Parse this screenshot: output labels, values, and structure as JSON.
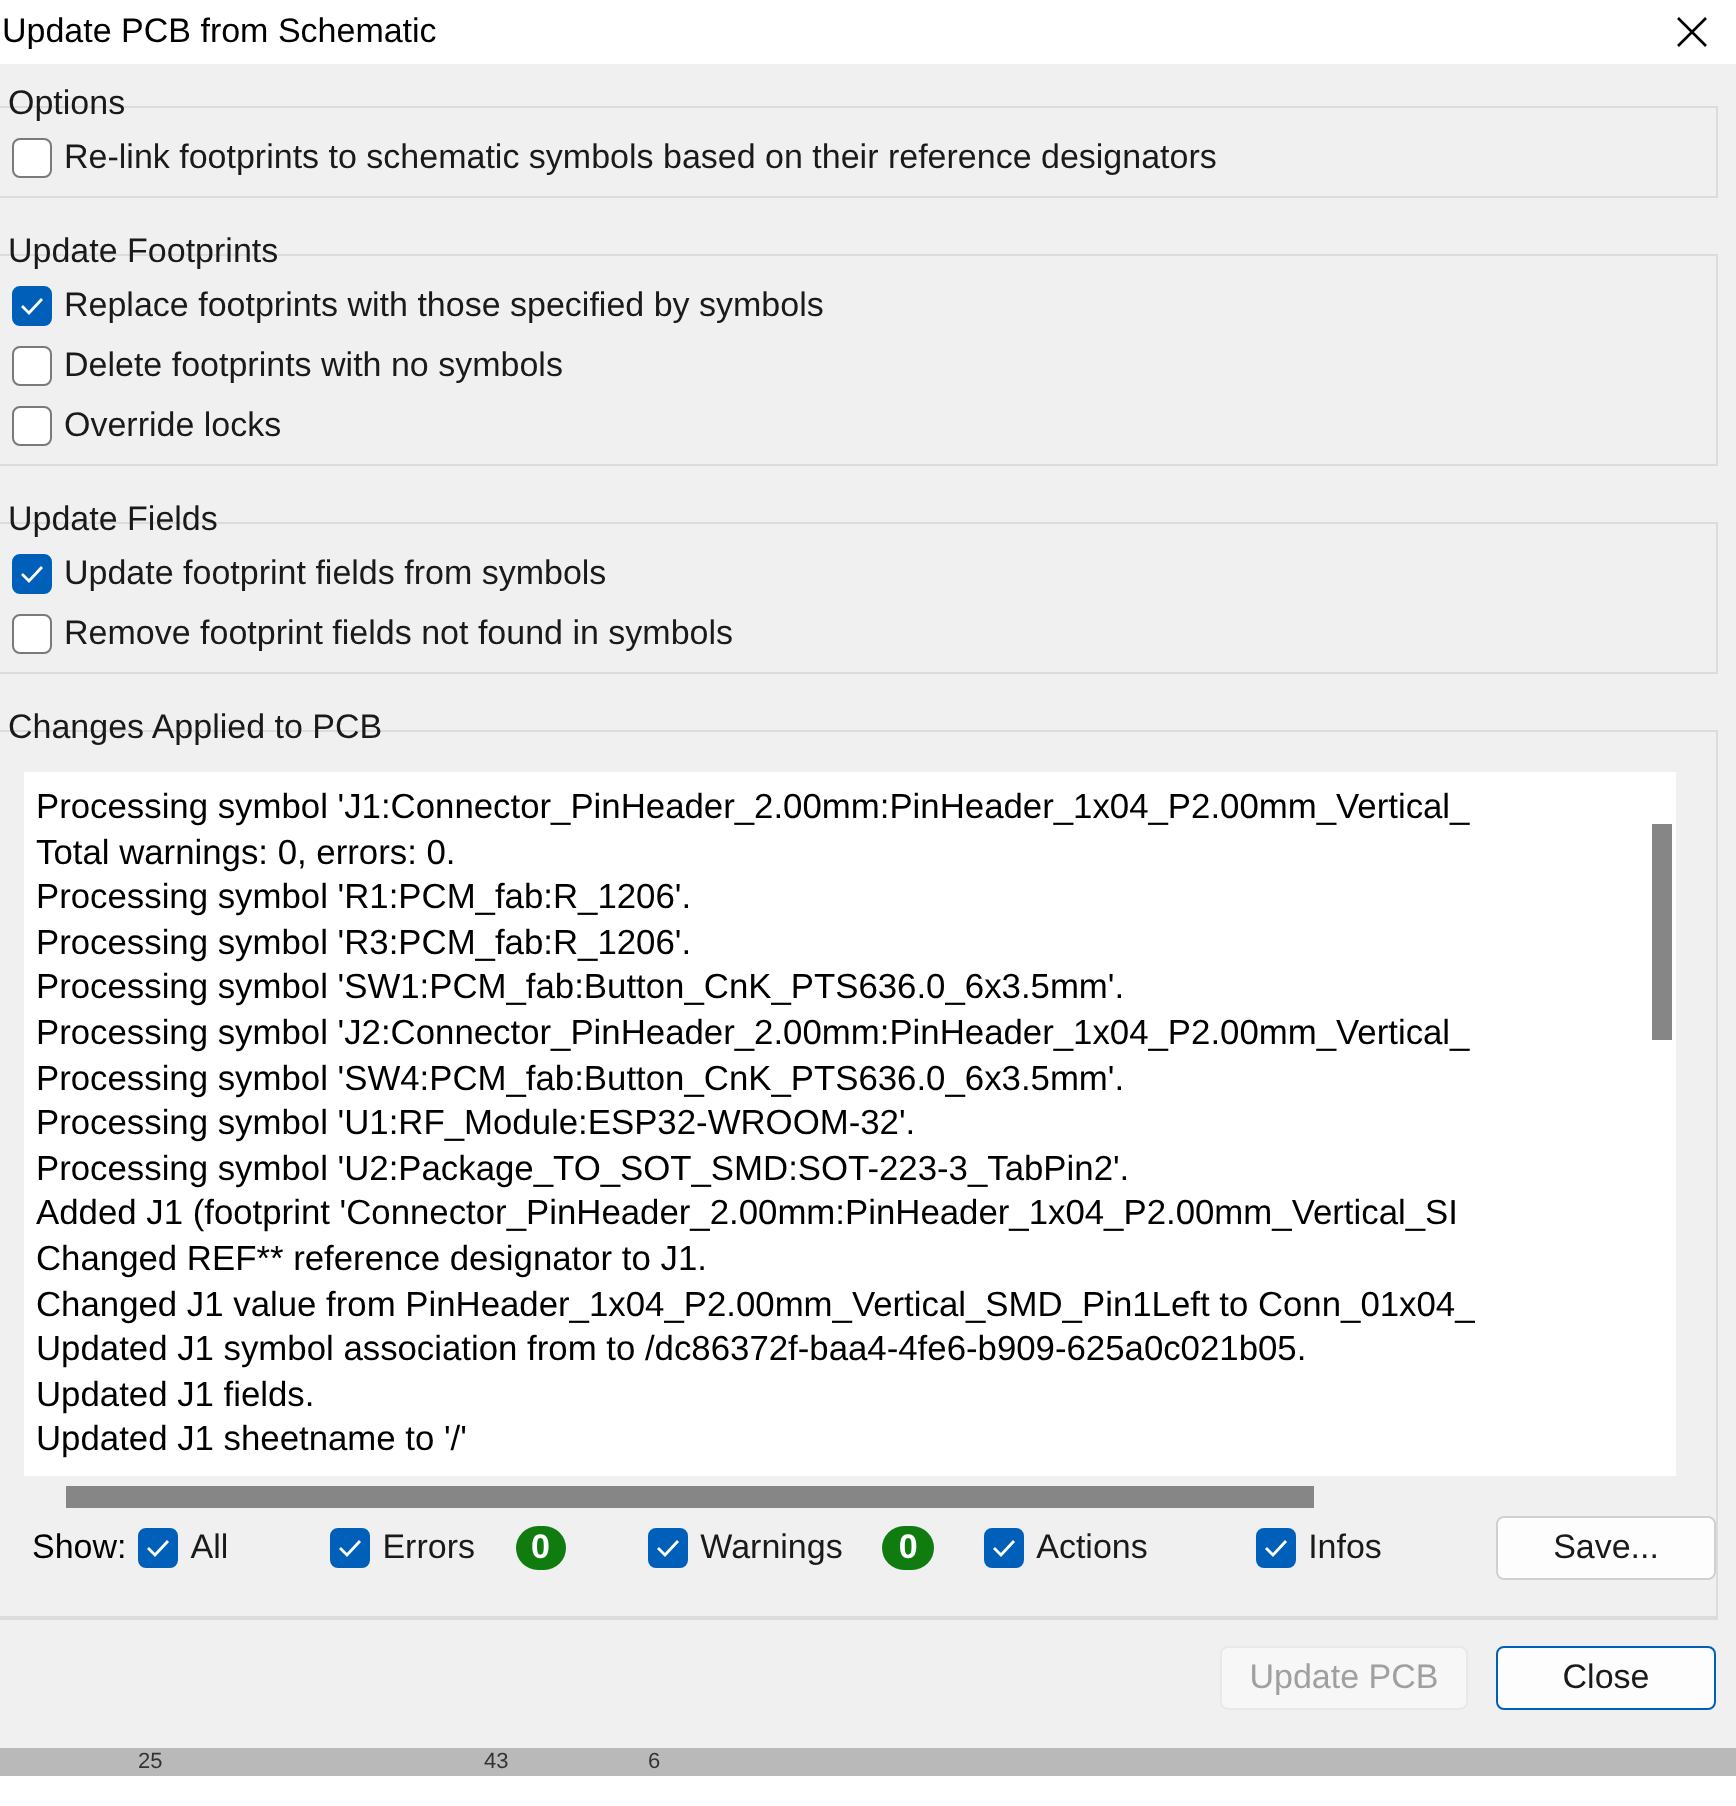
{
  "window": {
    "title": "Update PCB from Schematic"
  },
  "groups": [
    {
      "title": "Options",
      "options": [
        {
          "label": "Re-link footprints to schematic symbols based on their reference designators",
          "checked": false
        }
      ]
    },
    {
      "title": "Update Footprints",
      "options": [
        {
          "label": "Replace footprints with those specified by symbols",
          "checked": true
        },
        {
          "label": "Delete footprints with no symbols",
          "checked": false
        },
        {
          "label": "Override locks",
          "checked": false
        }
      ]
    },
    {
      "title": "Update Fields",
      "options": [
        {
          "label": "Update footprint fields from symbols",
          "checked": true
        },
        {
          "label": "Remove footprint fields not found in symbols",
          "checked": false
        }
      ]
    }
  ],
  "changes": {
    "title": "Changes Applied to PCB",
    "lines": [
      "Processing symbol 'J1:Connector_PinHeader_2.00mm:PinHeader_1x04_P2.00mm_Vertical_",
      "Total warnings: 0, errors: 0.",
      "Processing symbol 'R1:PCM_fab:R_1206'.",
      "Processing symbol 'R3:PCM_fab:R_1206'.",
      "Processing symbol 'SW1:PCM_fab:Button_CnK_PTS636.0_6x3.5mm'.",
      "Processing symbol 'J2:Connector_PinHeader_2.00mm:PinHeader_1x04_P2.00mm_Vertical_",
      "Processing symbol 'SW4:PCM_fab:Button_CnK_PTS636.0_6x3.5mm'.",
      "Processing symbol 'U1:RF_Module:ESP32-WROOM-32'.",
      "Processing symbol 'U2:Package_TO_SOT_SMD:SOT-223-3_TabPin2'.",
      "Added J1 (footprint 'Connector_PinHeader_2.00mm:PinHeader_1x04_P2.00mm_Vertical_SI",
      "Changed REF** reference designator to J1.",
      "Changed J1 value from PinHeader_1x04_P2.00mm_Vertical_SMD_Pin1Left to Conn_01x04_",
      "Updated J1 symbol association from  to /dc86372f-baa4-4fe6-b909-625a0c021b05.",
      "Updated J1 fields.",
      "Updated J1 sheetname to '/'"
    ]
  },
  "show": {
    "label": "Show:",
    "filters": [
      {
        "label": "All",
        "checked": true
      },
      {
        "label": "Errors",
        "checked": true,
        "count": "0"
      },
      {
        "label": "Warnings",
        "checked": true,
        "count": "0"
      },
      {
        "label": "Actions",
        "checked": true
      },
      {
        "label": "Infos",
        "checked": true
      }
    ]
  },
  "buttons": [
    {
      "label": "Save...",
      "disabled": false
    },
    {
      "label": "Update PCB",
      "disabled": true
    },
    {
      "label": "Close",
      "disabled": false,
      "default": true
    }
  ],
  "background_numbers": [
    "25",
    "43",
    "6"
  ]
}
